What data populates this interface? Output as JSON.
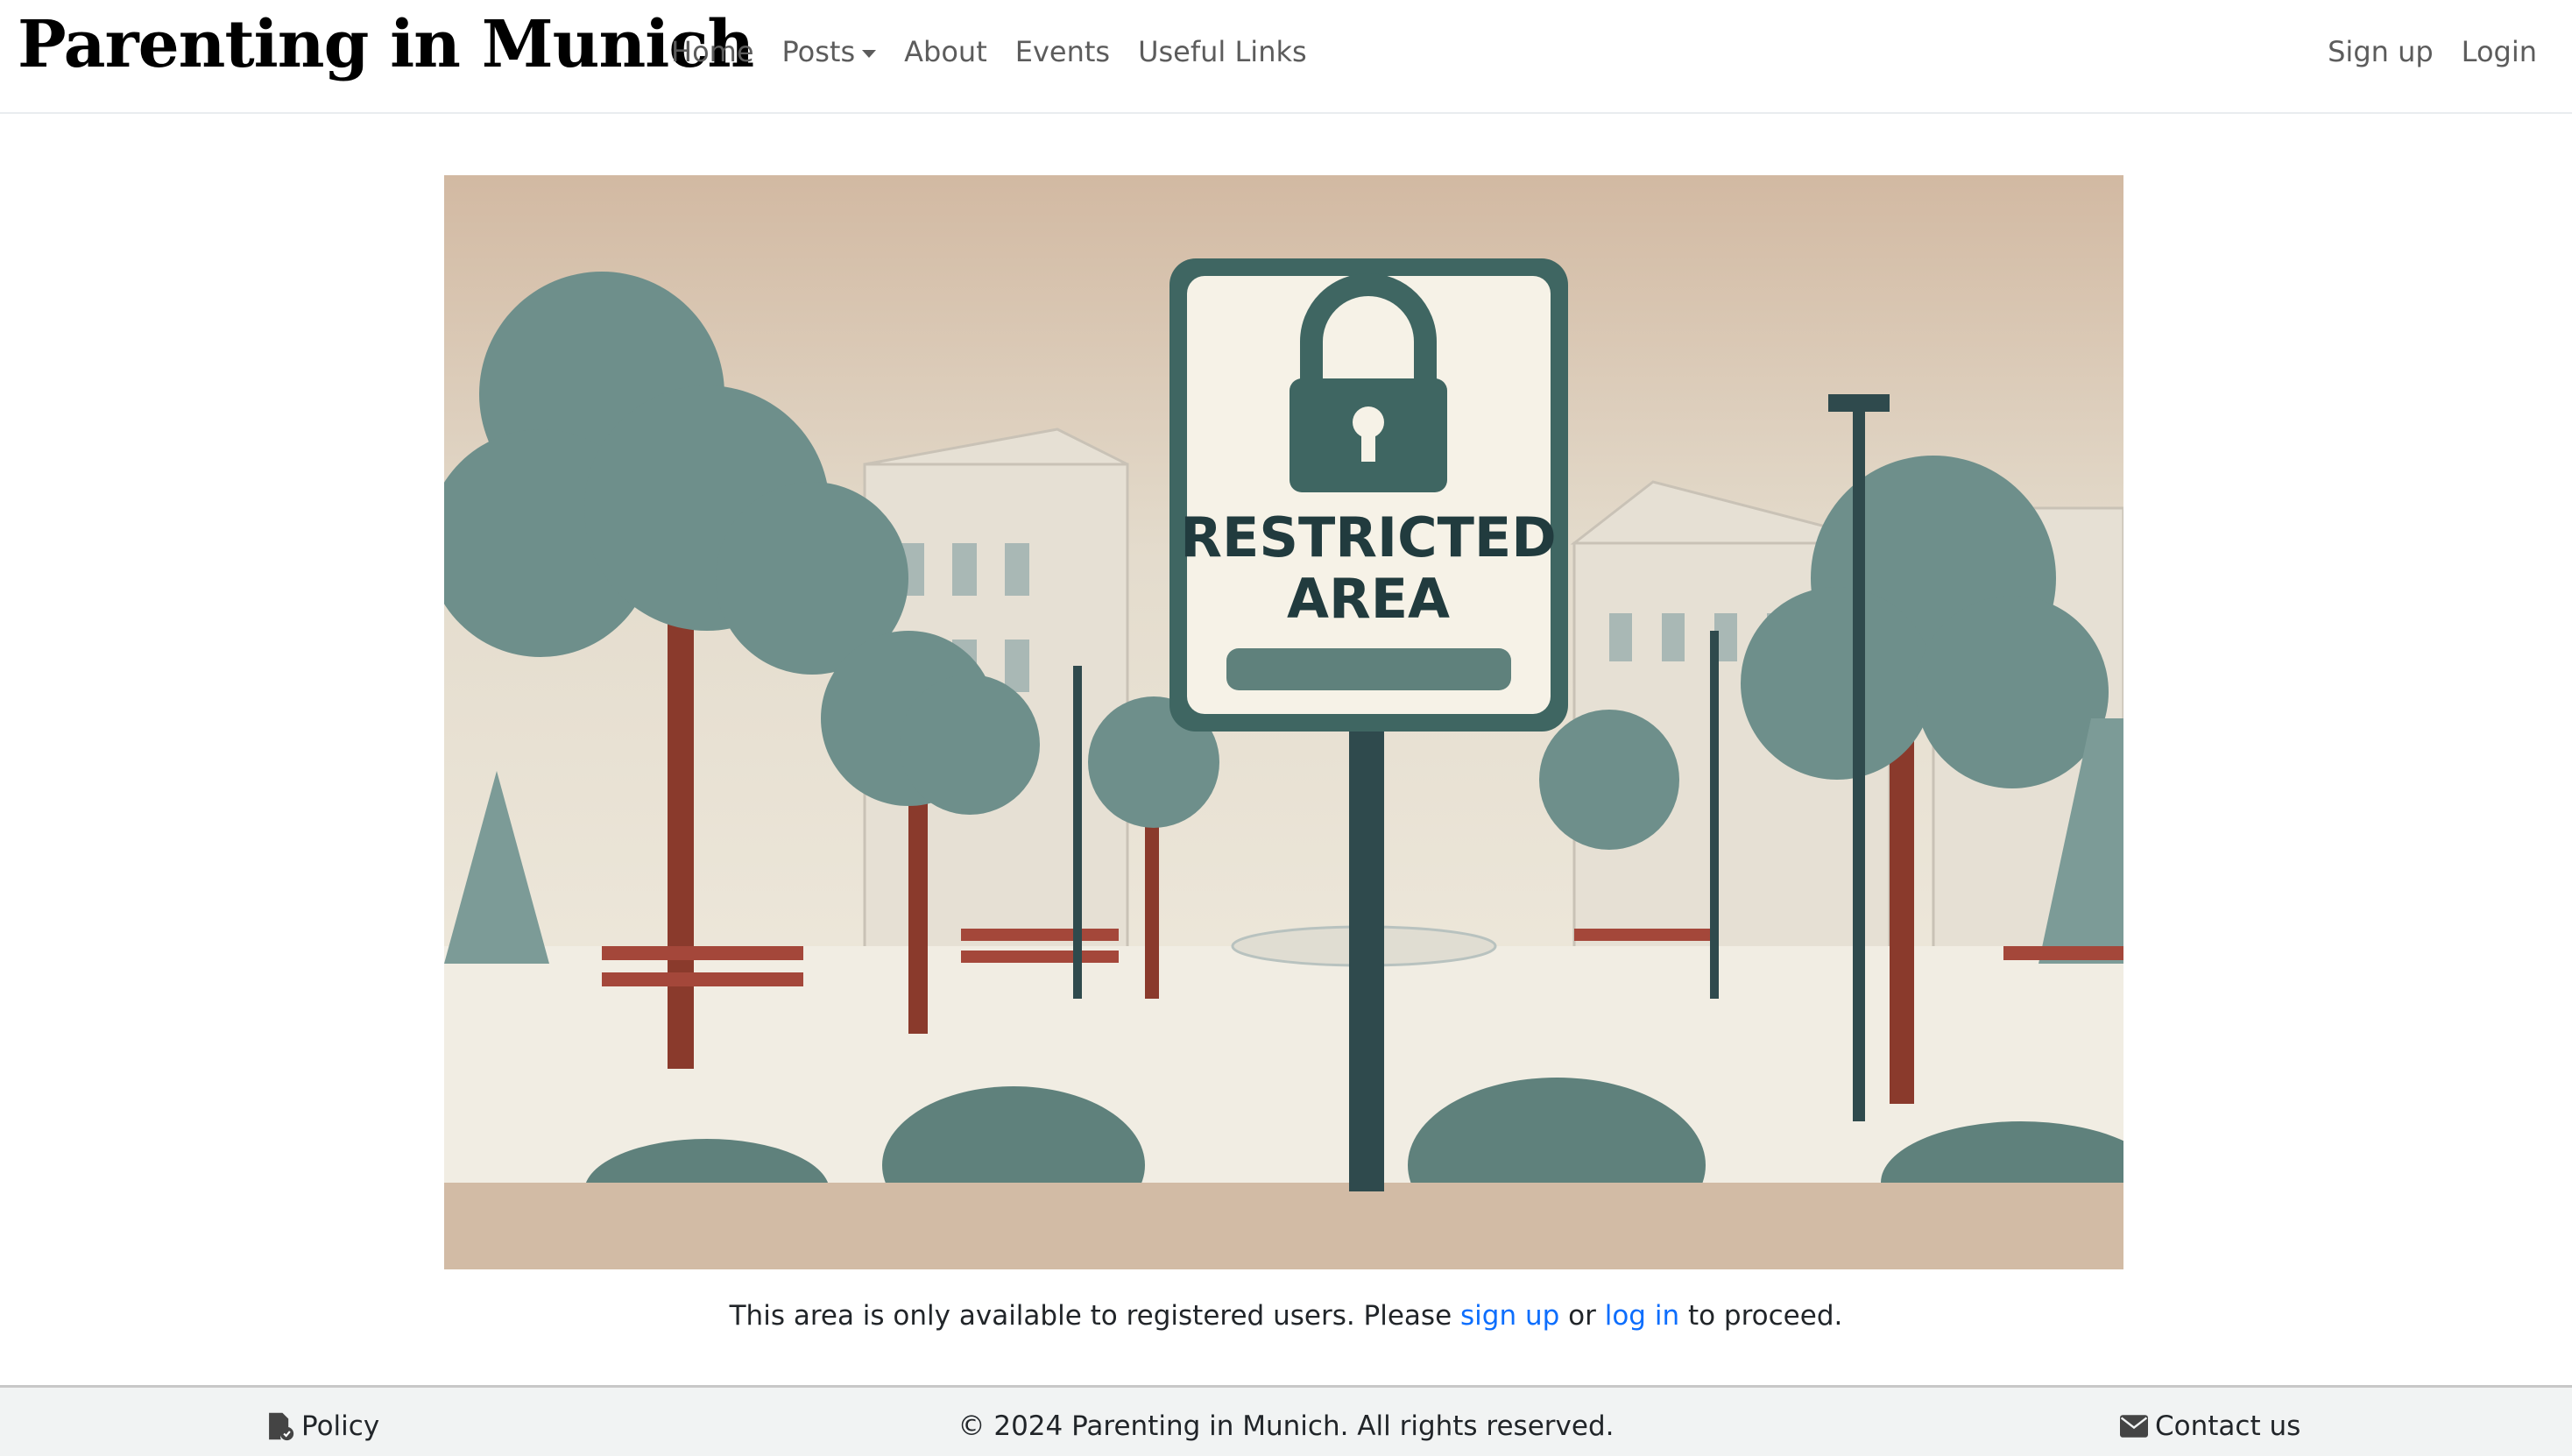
{
  "nav": {
    "brand": "Parenting in Munich",
    "links": [
      "Home",
      "Posts",
      "About",
      "Events",
      "Useful Links"
    ],
    "sign_up": "Sign up",
    "login": "Login"
  },
  "hero": {
    "sign_line1": "RESTRICTED",
    "sign_line2": "AREA",
    "icon": "padlock-icon"
  },
  "message": {
    "before": "This area is only available to registered users. Please ",
    "sign_up_link": "sign up",
    "middle": " or ",
    "log_in_link": "log in",
    "after": " to proceed.",
    "link_color": "#0d6efd"
  },
  "footer": {
    "policy": "Policy",
    "copyright": "© 2024 Parenting in Munich. All rights reserved.",
    "contact": "Contact us"
  }
}
